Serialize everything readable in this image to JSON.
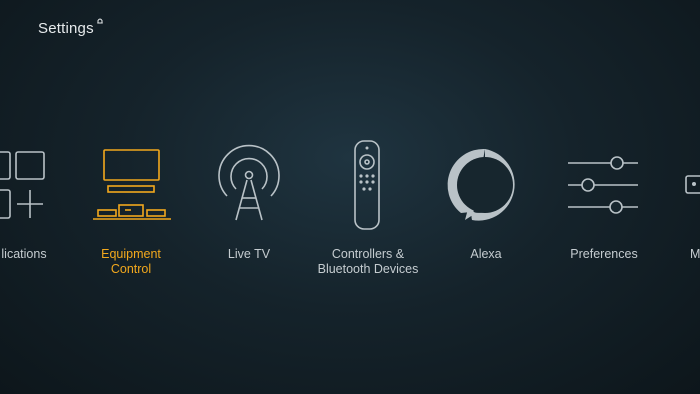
{
  "header": {
    "title": "Settings"
  },
  "items": [
    {
      "label_lines": [
        "lications"
      ],
      "icon": "applications-grid-icon"
    },
    {
      "label_lines": [
        "Equipment",
        "Control"
      ],
      "icon": "equipment-control-icon",
      "selected": true
    },
    {
      "label_lines": [
        "Live TV"
      ],
      "icon": "antenna-tower-icon"
    },
    {
      "label_lines": [
        "Controllers &",
        "Bluetooth Devices"
      ],
      "icon": "remote-control-icon"
    },
    {
      "label_lines": [
        "Alexa"
      ],
      "icon": "alexa-ring-icon"
    },
    {
      "label_lines": [
        "Preferences"
      ],
      "icon": "sliders-icon"
    },
    {
      "label_lines": [
        "M"
      ],
      "icon": "my-fire-tv-icon"
    }
  ],
  "colors": {
    "accent": "#f2a81d",
    "icon": "#b9c2c7",
    "text": "#c5ccd0"
  }
}
